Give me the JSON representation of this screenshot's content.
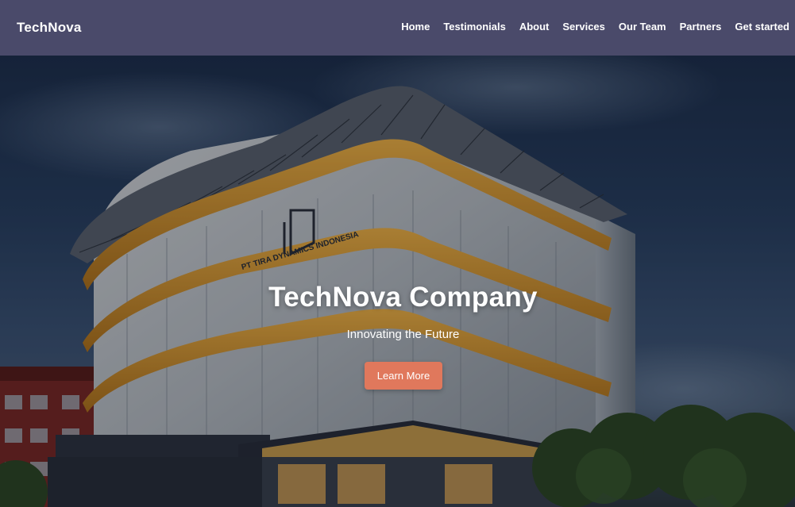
{
  "navbar": {
    "brand": "TechNova",
    "links": [
      "Home",
      "Testimonials",
      "About",
      "Services",
      "Our Team",
      "Partners",
      "Get started"
    ]
  },
  "hero": {
    "title": "TechNova Company",
    "subtitle": "Innovating the Future",
    "cta_label": "Learn More",
    "background_image": "corporate office building at dusk",
    "building_sign": "PT TIRA DYNAMICS INDONESIA"
  },
  "colors": {
    "navbar_bg": "#4a4a6a",
    "cta_bg": "#e0785c",
    "text": "#ffffff"
  }
}
